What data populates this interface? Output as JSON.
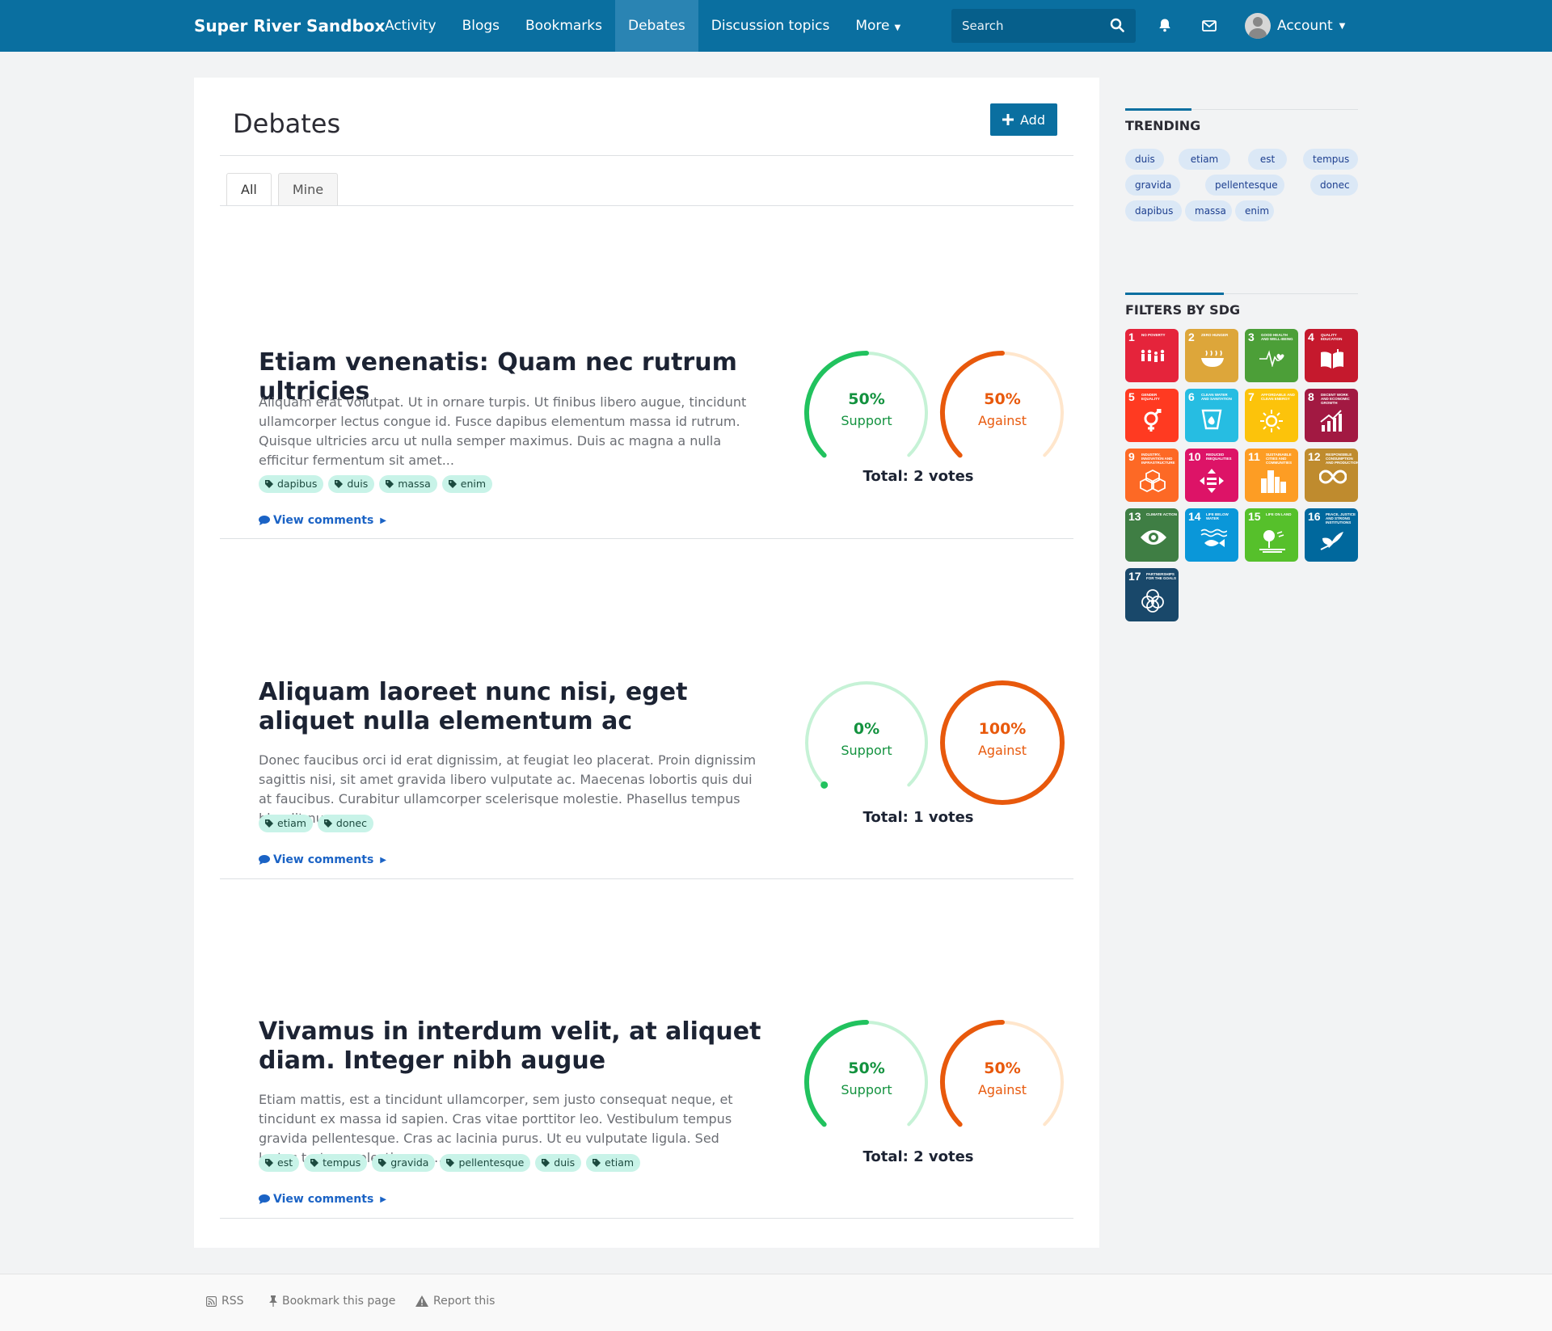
{
  "nav": {
    "brand": "Super River Sandbox",
    "links": [
      {
        "label": "Activity"
      },
      {
        "label": "Blogs"
      },
      {
        "label": "Bookmarks"
      },
      {
        "label": "Debates",
        "active": true
      },
      {
        "label": "Discussion topics"
      },
      {
        "label": "More"
      }
    ],
    "search_placeholder": "Search",
    "account_label": "Account",
    "colors": {
      "bar": "#0a6fa0",
      "active": "#2a84b3"
    }
  },
  "page": {
    "title": "Debates",
    "add_label": "Add",
    "tabs": [
      {
        "label": "All",
        "active": true
      },
      {
        "label": "Mine"
      }
    ]
  },
  "debates": [
    {
      "title": "Etiam venenatis: Quam nec rutrum ultricies",
      "body": "Aliquam erat volutpat. Ut in ornare turpis. Ut finibus libero augue, tincidunt ullamcorper lectus congue id. Fusce dapibus elementum massa id rutrum. Quisque ultricies arcu ut nulla semper maximus. Duis ac magna a nulla efficitur fermentum sit amet...",
      "tags": [
        "dapibus",
        "duis",
        "massa",
        "enim"
      ],
      "view_comments": "View comments",
      "support": {
        "pct": "50%",
        "label": "Support",
        "fraction": 0.5
      },
      "against": {
        "pct": "50%",
        "label": "Against",
        "fraction": 0.5
      },
      "total": "Total: 2 votes"
    },
    {
      "title": "Aliquam laoreet nunc nisi, eget aliquet nulla elementum ac",
      "body": "Donec faucibus orci id erat dignissim, at feugiat leo placerat. Proin dignissim sagittis nisi, sit amet gravida libero vulputate ac. Maecenas lobortis quis dui at faucibus. Curabitur ullamcorper scelerisque molestie. Phasellus tempus blandit nunc...",
      "tags": [
        "etiam",
        "donec"
      ],
      "view_comments": "View comments",
      "support": {
        "pct": "0%",
        "label": "Support",
        "fraction": 0
      },
      "against": {
        "pct": "100%",
        "label": "Against",
        "fraction": 1
      },
      "total": "Total: 1 votes"
    },
    {
      "title": "Vivamus in interdum velit, at aliquet diam. Integer nibh augue",
      "body": "Etiam mattis, est a tincidunt ullamcorper, sem justo consequat neque, et tincidunt ex massa id sapien. Cras vitae porttitor leo. Vestibulum tempus gravida pellentesque. Cras ac lacinia purus. Ut eu vulputate ligula. Sed lectus tortor, molestie non...",
      "tags": [
        "est",
        "tempus",
        "gravida",
        "pellentesque",
        "duis",
        "etiam"
      ],
      "view_comments": "View comments",
      "support": {
        "pct": "50%",
        "label": "Support",
        "fraction": 0.5
      },
      "against": {
        "pct": "50%",
        "label": "Against",
        "fraction": 0.5
      },
      "total": "Total: 2 votes"
    }
  ],
  "sidebar": {
    "trending_title": "TRENDING",
    "trending": [
      "duis",
      "etiam",
      "est",
      "tempus",
      "gravida",
      "pellentesque",
      "donec",
      "dapibus",
      "massa",
      "enim"
    ],
    "sdg_title": "FILTERS BY SDG",
    "sdgs": [
      {
        "num": "1",
        "caption": "No poverty",
        "color": "#e5243b",
        "icon": "people-icon"
      },
      {
        "num": "2",
        "caption": "Zero hunger",
        "color": "#dda63a",
        "icon": "bowl-icon"
      },
      {
        "num": "3",
        "caption": "Good health and well-being",
        "color": "#4c9f38",
        "icon": "heartbeat-icon"
      },
      {
        "num": "4",
        "caption": "Quality education",
        "color": "#c5192d",
        "icon": "book-icon"
      },
      {
        "num": "5",
        "caption": "Gender equality",
        "color": "#ff3a21",
        "icon": "gender-icon"
      },
      {
        "num": "6",
        "caption": "Clean water and sanitation",
        "color": "#26bde2",
        "icon": "water-icon"
      },
      {
        "num": "7",
        "caption": "Affordable and clean energy",
        "color": "#fcc30b",
        "icon": "sun-icon"
      },
      {
        "num": "8",
        "caption": "Decent work and economic growth",
        "color": "#a21942",
        "icon": "growth-icon"
      },
      {
        "num": "9",
        "caption": "Industry, innovation and infrastructure",
        "color": "#fd6925",
        "icon": "cubes-icon"
      },
      {
        "num": "10",
        "caption": "Reduced inequalities",
        "color": "#dd1367",
        "icon": "equal-icon"
      },
      {
        "num": "11",
        "caption": "Sustainable cities and communities",
        "color": "#fd9d24",
        "icon": "city-icon"
      },
      {
        "num": "12",
        "caption": "Responsible consumption and production",
        "color": "#bf8b2e",
        "icon": "infinity-icon"
      },
      {
        "num": "13",
        "caption": "Climate action",
        "color": "#3f7e44",
        "icon": "eye-icon"
      },
      {
        "num": "14",
        "caption": "Life below water",
        "color": "#0a97d9",
        "icon": "fish-icon"
      },
      {
        "num": "15",
        "caption": "Life on land",
        "color": "#56c02b",
        "icon": "tree-icon"
      },
      {
        "num": "16",
        "caption": "Peace, justice and strong institutions",
        "color": "#00689d",
        "icon": "dove-icon"
      },
      {
        "num": "17",
        "caption": "Partnerships for the goals",
        "color": "#19486a",
        "icon": "rings-icon"
      }
    ]
  },
  "footer": {
    "items": [
      {
        "label": "RSS",
        "icon": "rss-icon"
      },
      {
        "label": "Bookmark this page",
        "icon": "pin-icon"
      },
      {
        "label": "Report this",
        "icon": "warning-icon"
      }
    ]
  },
  "colors": {
    "support": "#21c25e",
    "support_track": "#c6f2d6",
    "support_text": "#13923f",
    "against": "#e8590c",
    "against_track": "#ffe6cc",
    "against_text": "#e8590c",
    "tag_bg": "#c8f3e8",
    "link": "#1b63c5"
  }
}
